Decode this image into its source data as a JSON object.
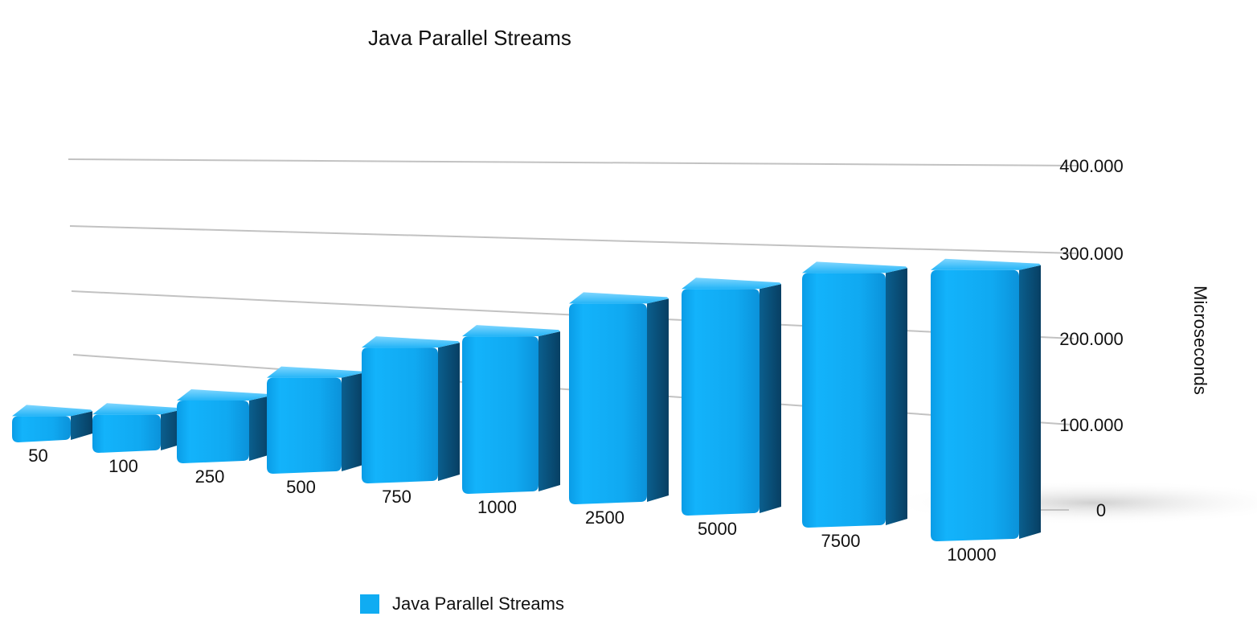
{
  "chart_data": {
    "type": "bar",
    "title": "Java Parallel Streams",
    "xlabel": "",
    "ylabel": "Microseconds",
    "categories": [
      "50",
      "100",
      "250",
      "500",
      "750",
      "1000",
      "2500",
      "5000",
      "7500",
      "10000"
    ],
    "series": [
      {
        "name": "Java Parallel Streams",
        "values": [
          28000,
          42000,
          70000,
          108000,
          153000,
          177000,
          225000,
          253000,
          283000,
          300000
        ],
        "color": "#10acf2"
      }
    ],
    "ylim": [
      0,
      400000
    ],
    "y_ticks": [
      "0",
      "100.000",
      "200.000",
      "300.000",
      "400.000"
    ],
    "grid": true,
    "legend": "bottom",
    "style": "3d"
  }
}
